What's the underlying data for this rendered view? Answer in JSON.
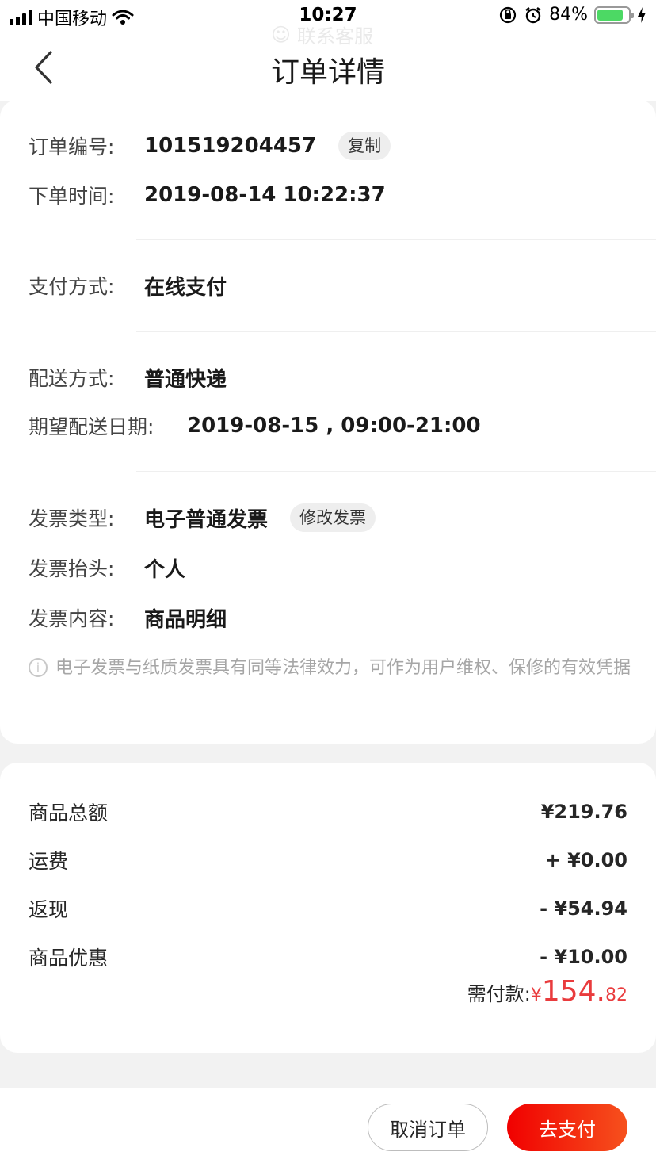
{
  "status_bar": {
    "carrier": "中国移动",
    "time": "10:27",
    "battery": "84%",
    "battery_level": 0.84
  },
  "nav": {
    "title": "订单详情",
    "ghost_service": "联系客服",
    "back_icon": "chevron-left-icon"
  },
  "order_info": {
    "order_no_label": "订单编号:",
    "order_no": "101519204457",
    "copy_label": "复制",
    "order_time_label": "下单时间:",
    "order_time": "2019-08-14 10:22:37",
    "payment_label": "支付方式:",
    "payment": "在线支付",
    "delivery_label": "配送方式:",
    "delivery": "普通快递",
    "expected_date_label": "期望配送日期:",
    "expected_date": "2019-08-15 , 09:00-21:00",
    "invoice_type_label": "发票类型:",
    "invoice_type": "电子普通发票",
    "edit_invoice_label": "修改发票",
    "invoice_title_label": "发票抬头:",
    "invoice_title": "个人",
    "invoice_content_label": "发票内容:",
    "invoice_content": "商品明细",
    "note": "电子发票与纸质发票具有同等法律效力，可作为用户维权、保修的有效凭据"
  },
  "price": {
    "goods_total_label": "商品总额",
    "goods_total": "¥219.76",
    "shipping_label": "运费",
    "shipping": "+ ¥0.00",
    "cashback_label": "返现",
    "cashback": "- ¥54.94",
    "discount_label": "商品优惠",
    "discount": "- ¥10.00",
    "payable_label": "需付款:",
    "payable_currency": "¥",
    "payable_int": "154.",
    "payable_dec": "82"
  },
  "actions": {
    "cancel_label": "取消订单",
    "pay_label": "去支付"
  },
  "colors": {
    "accent": "#e93b3d",
    "pay_gradient_start": "#f10000",
    "pay_gradient_end": "#f6511d"
  }
}
